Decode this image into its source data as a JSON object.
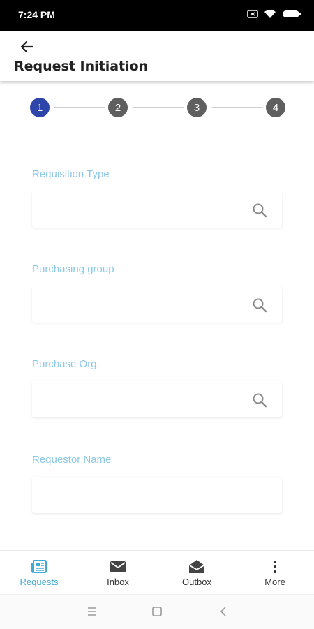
{
  "status_bar": {
    "time": "7:24 PM",
    "icons": [
      "screen-cast-icon",
      "wifi-icon",
      "battery-icon"
    ]
  },
  "header": {
    "back_icon": "arrow-left-icon",
    "title": "Request Initiation"
  },
  "stepper": {
    "steps": [
      "1",
      "2",
      "3",
      "4"
    ],
    "active_step": "1"
  },
  "form": {
    "fields": [
      {
        "label": "Requisition Type",
        "value": "",
        "icon": "search-icon"
      },
      {
        "label": "Purchasing group",
        "value": "",
        "icon": "search-icon"
      },
      {
        "label": "Purchase Org.",
        "value": "",
        "icon": "search-icon"
      },
      {
        "label": "Requestor Name",
        "value": ""
      }
    ]
  },
  "bottom_nav": {
    "items": [
      {
        "label": "Requests",
        "icon": "newspaper-icon",
        "active": true
      },
      {
        "label": "Inbox",
        "icon": "mail-icon",
        "active": false
      },
      {
        "label": "Outbox",
        "icon": "open-envelope-icon",
        "active": false
      },
      {
        "label": "More",
        "icon": "more-vertical-icon",
        "active": false
      }
    ]
  },
  "system_nav": {
    "buttons": [
      "menu-icon",
      "home-square-icon",
      "back-chevron-icon"
    ]
  },
  "colors": {
    "active_step": "#2e45a9",
    "inactive_step": "#5f5f5f",
    "field_label": "#8dc8e6",
    "active_nav": "#43a9d6",
    "status_bar": "#000000"
  }
}
